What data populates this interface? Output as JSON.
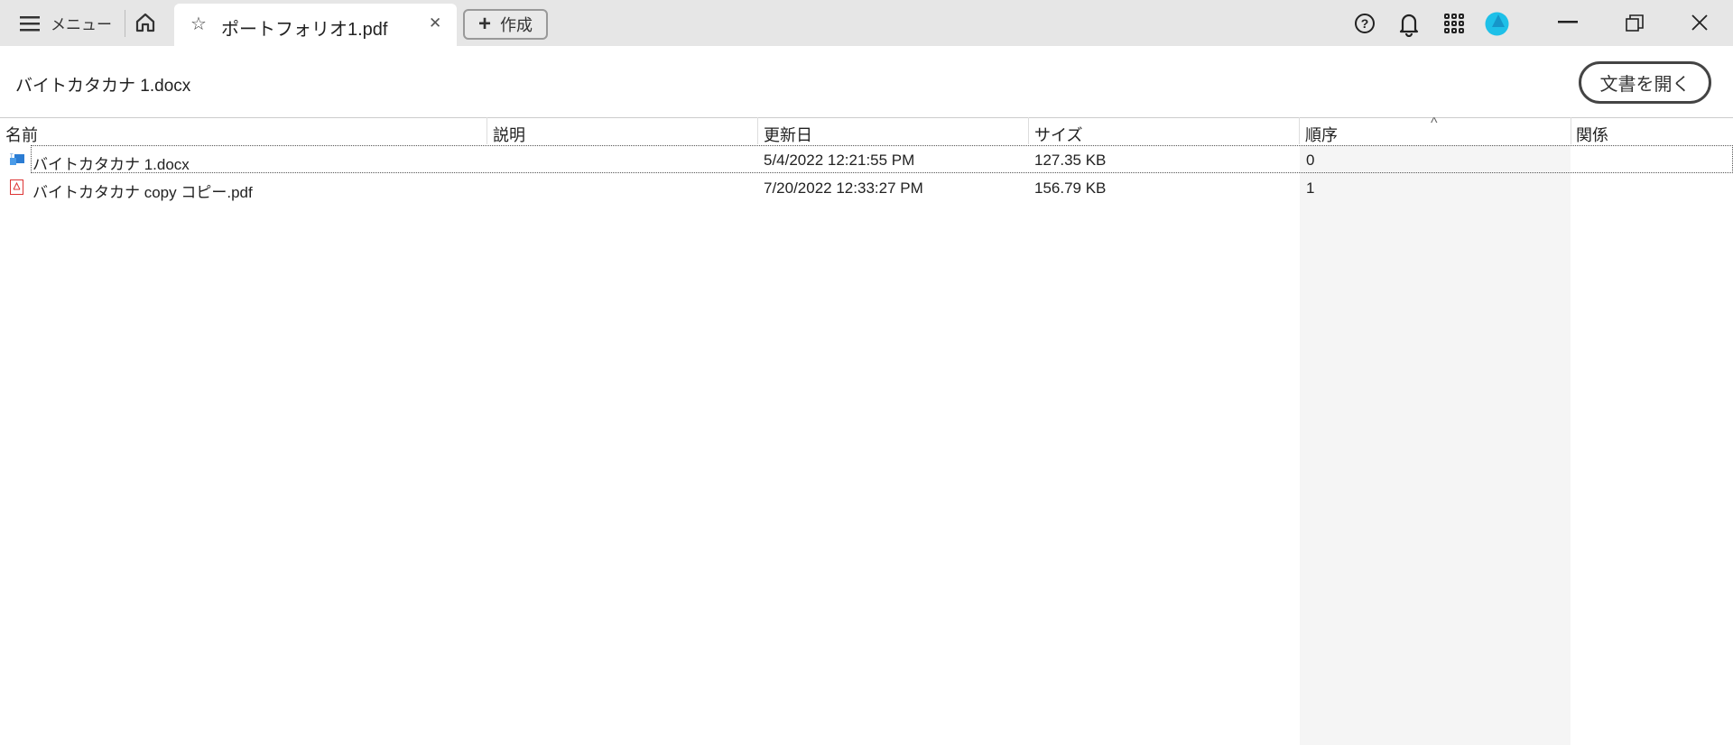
{
  "topbar": {
    "menu_label": "メニュー",
    "tab_title": "ポートフォリオ1.pdf",
    "create_label": "作成"
  },
  "header": {
    "document_title": "バイトカタカナ 1.docx",
    "open_button": "文書を開く"
  },
  "table": {
    "columns": [
      "名前",
      "説明",
      "更新日",
      "サイズ",
      "順序",
      "関係"
    ],
    "sort_indicator": "^",
    "rows": [
      {
        "icon": "word-file-icon",
        "name": "バイトカタカナ 1.docx",
        "description": "",
        "modified": "5/4/2022 12:21:55 PM",
        "size": "127.35 KB",
        "order": "0",
        "relation": ""
      },
      {
        "icon": "pdf-file-icon",
        "name": "バイトカタカナ copy コピー.pdf",
        "description": "",
        "modified": "7/20/2022 12:33:27 PM",
        "size": "156.79 KB",
        "order": "1",
        "relation": ""
      }
    ]
  },
  "colors": {
    "avatar": "#1ec0e8",
    "topbar": "#e6e6e6",
    "sorted_column": "#f5f5f5"
  }
}
